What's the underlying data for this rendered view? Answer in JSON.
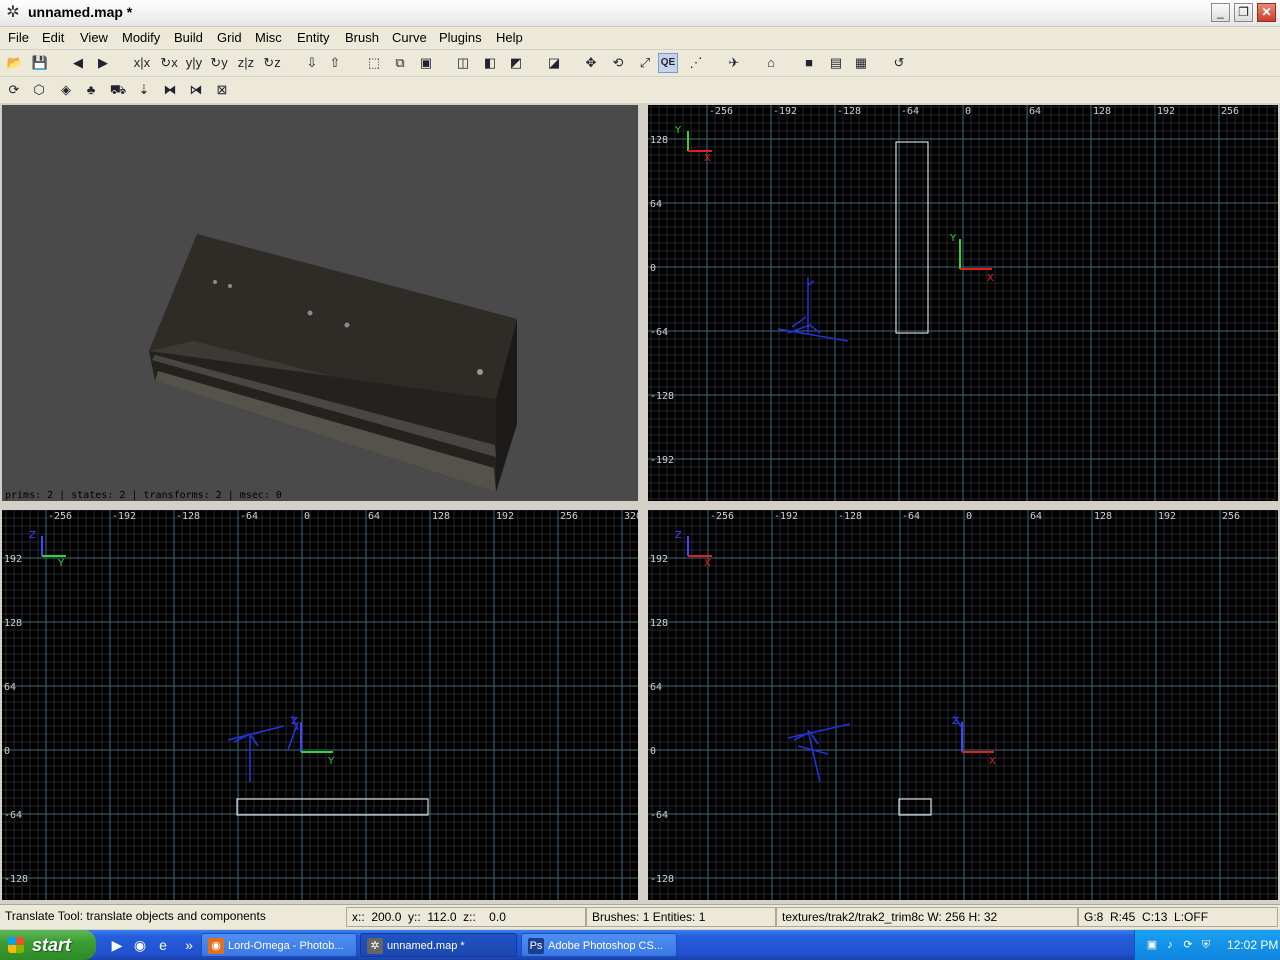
{
  "window": {
    "title": "unnamed.map *",
    "app_icon": "radiant-icon"
  },
  "window_controls": {
    "minimize": "_",
    "restore": "❐",
    "close": "✕"
  },
  "menu": [
    "File",
    "Edit",
    "View",
    "Modify",
    "Build",
    "Grid",
    "Misc",
    "Entity",
    "Brush",
    "Curve",
    "Plugins",
    "Help"
  ],
  "toolbar1": [
    {
      "icon": "open-folder-icon",
      "glyph": "📂"
    },
    {
      "icon": "save-icon",
      "glyph": "💾"
    },
    {
      "icon": "arrow-left-icon",
      "glyph": "◀"
    },
    {
      "icon": "arrow-right-icon",
      "glyph": "▶"
    },
    {
      "icon": "flip-x-icon",
      "glyph": "x|x"
    },
    {
      "icon": "rotate-x-icon",
      "glyph": "↻x"
    },
    {
      "icon": "flip-y-icon",
      "glyph": "y|y"
    },
    {
      "icon": "rotate-y-icon",
      "glyph": "↻y"
    },
    {
      "icon": "flip-z-icon",
      "glyph": "z|z"
    },
    {
      "icon": "rotate-z-icon",
      "glyph": "↻z"
    },
    {
      "icon": "select-complete-tall-icon",
      "glyph": "⇩"
    },
    {
      "icon": "select-touching-icon",
      "glyph": "⇧"
    },
    {
      "icon": "csg-subtract-icon",
      "glyph": "⬚"
    },
    {
      "icon": "csg-merge-icon",
      "glyph": "⧉"
    },
    {
      "icon": "csg-hollow-icon",
      "glyph": "▣"
    },
    {
      "icon": "clipper-icon",
      "glyph": "◫"
    },
    {
      "icon": "view-change-icon",
      "glyph": "◧"
    },
    {
      "icon": "view-cube-icon",
      "glyph": "◩"
    },
    {
      "icon": "camera-icon",
      "glyph": "◪"
    },
    {
      "icon": "translate-icon",
      "glyph": "✥"
    },
    {
      "icon": "rotate-tool-icon",
      "glyph": "⟲"
    },
    {
      "icon": "scale-tool-icon",
      "glyph": "⤢"
    },
    {
      "icon": "qe-tool-icon",
      "glyph": "QE",
      "active": true
    },
    {
      "icon": "vertex-edit-icon",
      "glyph": "⋰"
    },
    {
      "icon": "entity-icon",
      "glyph": "✈"
    },
    {
      "icon": "patch-icon",
      "glyph": "⌂"
    },
    {
      "icon": "texture-cube-icon",
      "glyph": "■"
    },
    {
      "icon": "texture-list-icon",
      "glyph": "▤"
    },
    {
      "icon": "checker-icon",
      "glyph": "▦"
    },
    {
      "icon": "refresh-icon",
      "glyph": "↺"
    }
  ],
  "toolbar2": [
    {
      "icon": "plugin-cycle-icon",
      "glyph": "⟳"
    },
    {
      "icon": "plugin-hexagon-icon",
      "glyph": "⬡"
    },
    {
      "icon": "plugin-shader-icon",
      "glyph": "◈"
    },
    {
      "icon": "plugin-tree-icon",
      "glyph": "♣"
    },
    {
      "icon": "plugin-tank-icon",
      "glyph": "⛟"
    },
    {
      "icon": "plugin-drop-icon",
      "glyph": "⇣"
    },
    {
      "icon": "plugin-mirror-icon",
      "glyph": "⧓"
    },
    {
      "icon": "plugin-split-icon",
      "glyph": "⧒"
    },
    {
      "icon": "plugin-clear-icon",
      "glyph": "⊠"
    }
  ],
  "camera": {
    "stats": "prims: 2 | states: 2 | transforms: 2 | msec: 0"
  },
  "views": {
    "xy": {
      "h_labels": [
        "-256",
        "-192",
        "-128",
        "-64",
        "0",
        "64",
        "128",
        "192",
        "256"
      ],
      "v_labels": [
        "128",
        "64",
        "0",
        "-64",
        "-128",
        "-192"
      ],
      "axis_v": "Y",
      "axis_h": "X"
    },
    "xz": {
      "h_labels": [
        "-256",
        "-192",
        "-128",
        "-64",
        "0",
        "64",
        "128",
        "192",
        "256",
        "320"
      ],
      "v_labels": [
        "192",
        "128",
        "64",
        "0",
        "-64",
        "-128"
      ],
      "axis_v": "Z",
      "axis_h": "Y"
    },
    "yz": {
      "h_labels": [
        "-256",
        "-192",
        "-128",
        "-64",
        "0",
        "64",
        "128",
        "192",
        "256"
      ],
      "v_labels": [
        "192",
        "128",
        "64",
        "0",
        "-64",
        "-128"
      ],
      "axis_v": "Z",
      "axis_h": "X"
    }
  },
  "status": {
    "hint": "Translate Tool: translate objects and components",
    "coords": "x::  200.0  y::  112.0  z::    0.0",
    "counts": "Brushes: 1 Entities: 1",
    "texture": "textures/trak2/trak2_trim8c W: 256 H: 32",
    "grid": "G:8  R:45  C:13  L:OFF"
  },
  "taskbar": {
    "start": "start",
    "quick_launch": [
      {
        "icon": "media-player-icon",
        "glyph": "▶"
      },
      {
        "icon": "firefox-icon",
        "glyph": "◉"
      },
      {
        "icon": "ie-icon",
        "glyph": "e"
      },
      {
        "icon": "more-icon",
        "glyph": "»"
      }
    ],
    "tasks": [
      {
        "label": "Lord-Omega - Photob...",
        "icon": "firefox-icon",
        "glyph": "◉",
        "active": false
      },
      {
        "label": "unnamed.map *",
        "icon": "radiant-icon",
        "glyph": "✲",
        "active": true
      },
      {
        "label": "Adobe Photoshop CS...",
        "icon": "photoshop-icon",
        "glyph": "Ps",
        "active": false
      }
    ],
    "tray_icons": [
      {
        "icon": "network-icon",
        "glyph": "▣"
      },
      {
        "icon": "volume-icon",
        "glyph": "♪"
      },
      {
        "icon": "sync-icon",
        "glyph": "⟳"
      },
      {
        "icon": "security-icon",
        "glyph": "⛨"
      }
    ],
    "clock": "12:02 PM"
  }
}
